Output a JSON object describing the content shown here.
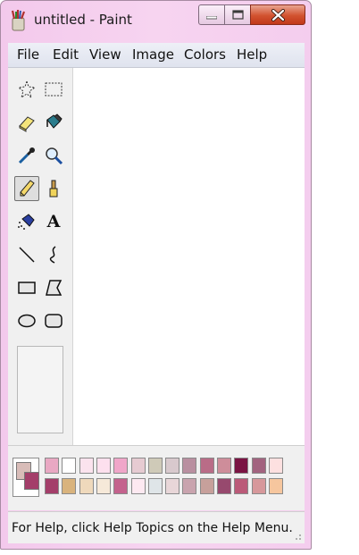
{
  "window": {
    "title": "untitled - Paint"
  },
  "menu": [
    "File",
    "Edit",
    "View",
    "Image",
    "Colors",
    "Help"
  ],
  "tools": [
    {
      "name": "free-form-select-tool",
      "icon": "free-form-select-icon"
    },
    {
      "name": "select-tool",
      "icon": "rect-select-icon"
    },
    {
      "name": "eraser-tool",
      "icon": "eraser-icon"
    },
    {
      "name": "fill-tool",
      "icon": "paint-bucket-icon"
    },
    {
      "name": "color-picker-tool",
      "icon": "eyedropper-icon"
    },
    {
      "name": "magnifier-tool",
      "icon": "magnifier-icon"
    },
    {
      "name": "pencil-tool",
      "icon": "pencil-icon",
      "selected": true
    },
    {
      "name": "brush-tool",
      "icon": "brush-icon"
    },
    {
      "name": "airbrush-tool",
      "icon": "airbrush-icon"
    },
    {
      "name": "text-tool",
      "icon": "text-icon",
      "glyph": "A"
    },
    {
      "name": "line-tool",
      "icon": "line-icon"
    },
    {
      "name": "curve-tool",
      "icon": "curve-icon"
    },
    {
      "name": "rectangle-tool",
      "icon": "rectangle-icon"
    },
    {
      "name": "polygon-tool",
      "icon": "polygon-icon"
    },
    {
      "name": "ellipse-tool",
      "icon": "ellipse-icon"
    },
    {
      "name": "rounded-rectangle-tool",
      "icon": "rounded-rectangle-icon"
    }
  ],
  "colors": {
    "foreground": "#d8bcb8",
    "background": "#a43e6a",
    "palette_row1": [
      "#e9a8c3",
      "#ffffff",
      "#fbe3ee",
      "#fde0ee",
      "#f0a6c9",
      "#e6cbd2",
      "#cfcab8",
      "#d8c9cd",
      "#b98fa0",
      "#b96c87",
      "#ce8d9a",
      "#7a1443",
      "#a2637f",
      "#fde0e0"
    ],
    "palette_row2": [
      "#a43e6a",
      "#d9b37d",
      "#efd9bc",
      "#f6e9d9",
      "#c4628d",
      "#fde9f1",
      "#dfe5e8",
      "#e8d6d8",
      "#c9a3ae",
      "#c7a09b",
      "#97496e",
      "#bb5a78",
      "#d7989b",
      "#f6c69e"
    ]
  },
  "status": {
    "text": "For Help, click Help Topics on the Help Menu."
  }
}
